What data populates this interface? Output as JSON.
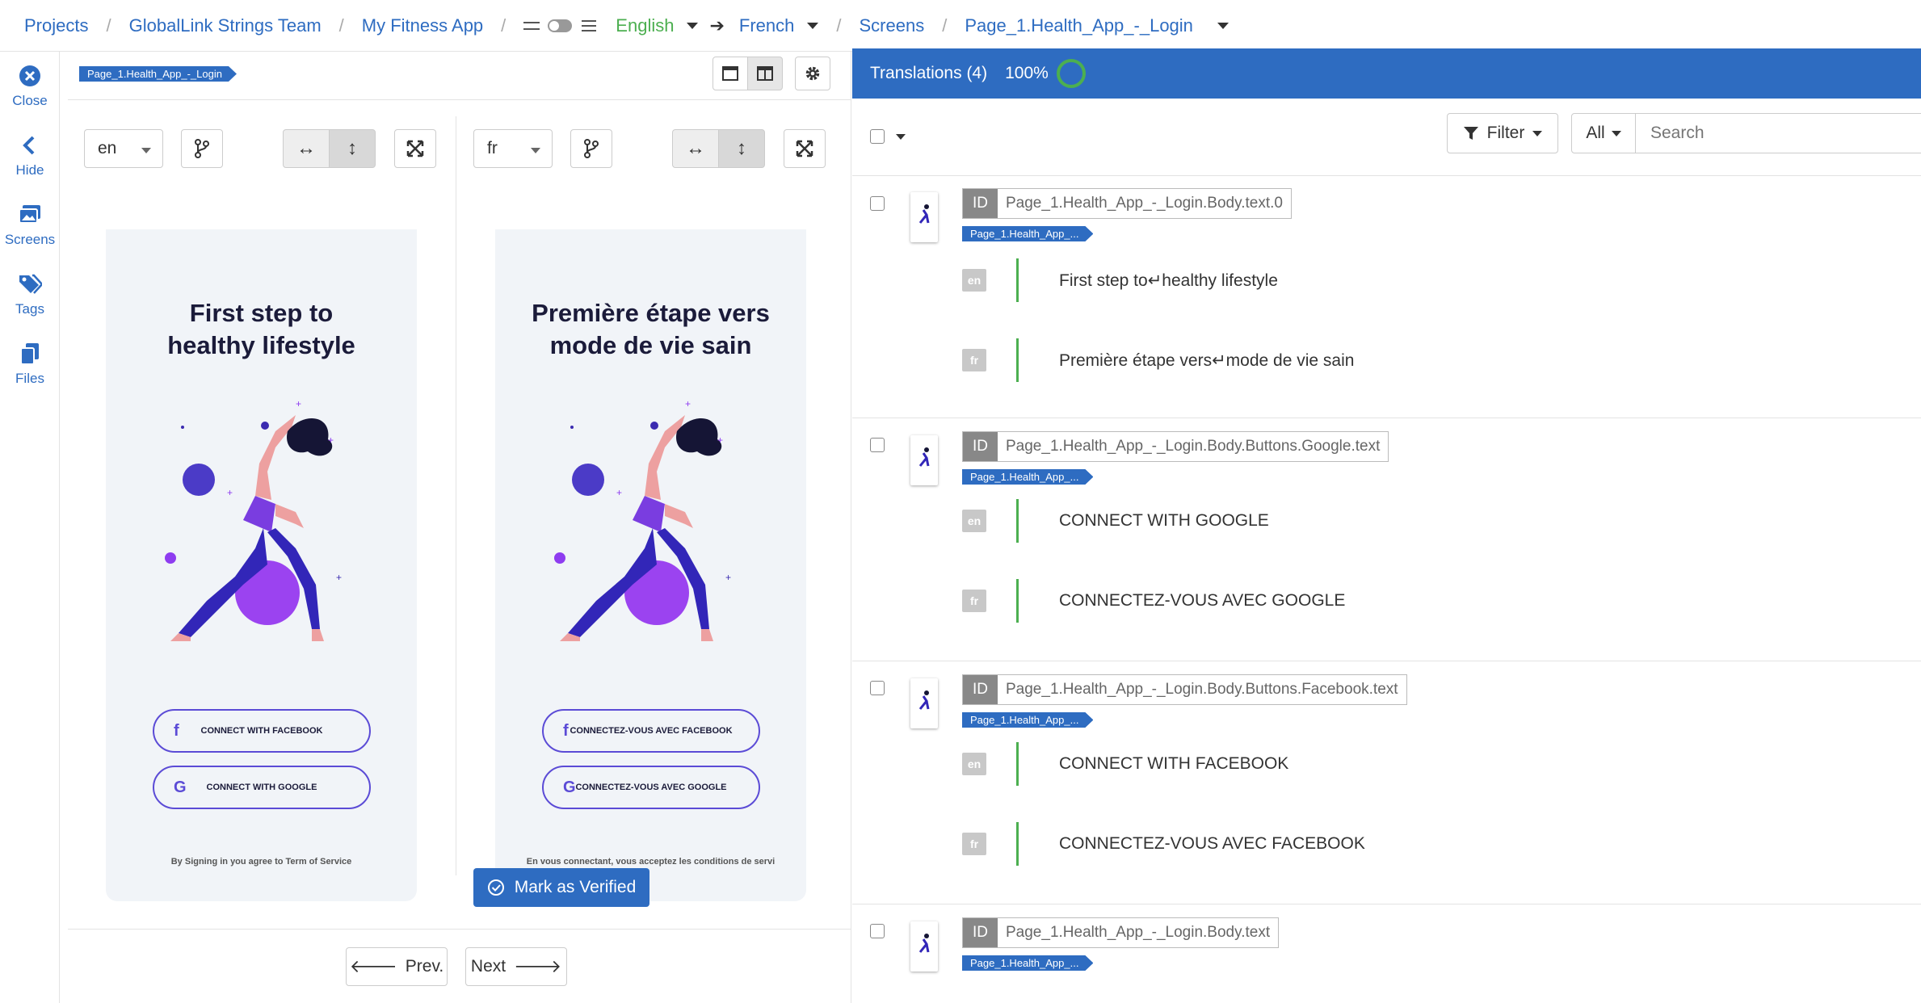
{
  "breadcrumb": {
    "projects": "Projects",
    "team": "GlobalLink Strings Team",
    "app": "My Fitness App",
    "source_lang": "English",
    "target_lang": "French",
    "screens": "Screens",
    "page": "Page_1.Health_App_-_Login"
  },
  "sidebar": {
    "items": [
      {
        "label": "Close",
        "icon": "close-circle-icon"
      },
      {
        "label": "Hide",
        "icon": "chevron-left-icon"
      },
      {
        "label": "Screens",
        "icon": "images-icon"
      },
      {
        "label": "Tags",
        "icon": "tags-icon"
      },
      {
        "label": "Files",
        "icon": "files-icon"
      }
    ]
  },
  "preview": {
    "screen_tag": "Page_1.Health_App_-_Login",
    "left": {
      "lang": "en",
      "title_line1": "First step to",
      "title_line2": "healthy lifestyle",
      "facebook_btn": "CONNECT WITH FACEBOOK",
      "google_btn": "CONNECT WITH GOOGLE",
      "terms": "By Signing in you agree to Term of Service"
    },
    "right": {
      "lang": "fr",
      "title_line1": "Première étape vers",
      "title_line2": "mode de vie sain",
      "facebook_btn": "CONNECTEZ-VOUS AVEC FACEBOOK",
      "google_btn": "CONNECTEZ-VOUS AVEC GOOGLE",
      "terms": "En vous connectant, vous acceptez les conditions de servi"
    },
    "verify_label": "Mark as Verified",
    "prev_label": "Prev.",
    "next_label": "Next"
  },
  "translations": {
    "header": "Translations (4)",
    "progress": "100%",
    "filter_label": "Filter",
    "all_label": "All",
    "search_placeholder": "Search",
    "entries": [
      {
        "id_label": "ID",
        "id": "Page_1.Health_App_-_Login.Body.text.0",
        "tag": "Page_1.Health_App_...",
        "en_label": "en",
        "en": "First step to↵healthy lifestyle",
        "fr_label": "fr",
        "fr": "Première étape vers↵mode de vie sain"
      },
      {
        "id_label": "ID",
        "id": "Page_1.Health_App_-_Login.Body.Buttons.Google.text",
        "tag": "Page_1.Health_App_...",
        "en_label": "en",
        "en": "CONNECT WITH GOOGLE",
        "fr_label": "fr",
        "fr": "CONNECTEZ-VOUS AVEC GOOGLE"
      },
      {
        "id_label": "ID",
        "id": "Page_1.Health_App_-_Login.Body.Buttons.Facebook.text",
        "tag": "Page_1.Health_App_...",
        "en_label": "en",
        "en": "CONNECT WITH FACEBOOK",
        "fr_label": "fr",
        "fr": "CONNECTEZ-VOUS AVEC FACEBOOK"
      },
      {
        "id_label": "ID",
        "id": "Page_1.Health_App_-_Login.Body.text",
        "tag": "Page_1.Health_App_..."
      }
    ]
  },
  "colors": {
    "accent": "#2e6cc1",
    "verified": "#4caf50"
  }
}
